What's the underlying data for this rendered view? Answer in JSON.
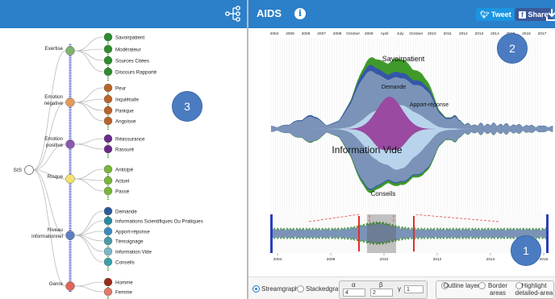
{
  "left": {
    "root_label": "SIS",
    "categories": [
      {
        "label": "Exertise",
        "items": [
          "Savoirpatient",
          "Modérateur",
          "Sources Citées",
          "Discours Rapporté"
        ]
      },
      {
        "label": "Emotion négative",
        "items": [
          "Peur",
          "Inquiétude",
          "Panique",
          "Angoisse"
        ]
      },
      {
        "label": "Emotion positive",
        "items": [
          "Réassurance",
          "Rassuré"
        ]
      },
      {
        "label": "Risque",
        "items": [
          "Anticipé",
          "Actuel",
          "Passé"
        ]
      },
      {
        "label": "Niveau informationnel",
        "items": [
          "Demande",
          "Informations Scientifiques Ou Pratiques",
          "Apport-réponse",
          "Témoignage",
          "Information Vide",
          "Conseils"
        ]
      },
      {
        "label": "Genre",
        "items": [
          "Homme",
          "Femme"
        ]
      }
    ],
    "badge": "3"
  },
  "header": {
    "title": "AIDS",
    "info_glyph": "i",
    "tweet_label": "Tweet",
    "share_label": "Share"
  },
  "timeline": {
    "top_ticks": [
      "2004",
      "2005",
      "2006",
      "2007",
      "2008",
      "October",
      "2009",
      "April",
      "July",
      "October",
      "2010",
      "2011",
      "2012",
      "2013",
      "2014",
      "2015",
      "2016",
      "2017"
    ],
    "bottom_ticks": [
      "2004",
      "2008",
      "2010",
      "2012",
      "2014",
      "2016"
    ],
    "stream_labels": [
      "Savoirpatient",
      "Demande",
      "Apport-réponse",
      "Information Vide",
      "Conseils"
    ],
    "badge_main": "2",
    "badge_overview": "1"
  },
  "controls": {
    "streamgraph_label": "Streamgraph",
    "stackedgraph_label": "Stackedgraph",
    "alpha_label": "α",
    "beta_label": "β",
    "gamma_label": "γ",
    "alpha_value": "4",
    "beta_value": "2",
    "gamma_value": "1",
    "outline_label": "Outline layers",
    "border_label": "Border areas",
    "highlight_label": "Highlight detailed-area"
  },
  "colors": {
    "header": "#2c7fc9",
    "stream_blue": "#7b93b8",
    "stream_light": "#b8d4ec",
    "stream_green": "#3f9a2a",
    "stream_dark": "#3556a8",
    "marker_red": "#e0302a",
    "marker_blue": "#2a3fb8"
  },
  "icons": [
    "tree-icon",
    "info-icon",
    "twitter-icon",
    "facebook-icon",
    "download-icon"
  ]
}
